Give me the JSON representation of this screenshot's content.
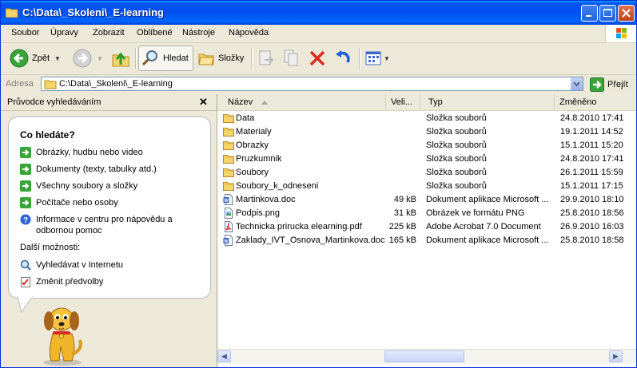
{
  "window": {
    "title": "C:\\Data\\_Skoleni\\_E-learning"
  },
  "menu": [
    "Soubor",
    "Úpravy",
    "Zobrazit",
    "Oblíbené",
    "Nástroje",
    "Nápověda"
  ],
  "toolbar": {
    "back": "Zpět",
    "search": "Hledat",
    "folders": "Složky"
  },
  "address": {
    "label": "Adresa",
    "path": "C:\\Data\\_Skoleni\\_E-learning",
    "go": "Přejít"
  },
  "search_pane": {
    "title": "Průvodce vyhledáváním",
    "question": "Co hledáte?",
    "links": [
      "Obrázky, hudbu nebo video",
      "Dokumenty (texty, tabulky atd.)",
      "Všechny soubory a složky",
      "Počítače nebo osoby",
      "Informace v centru pro nápovědu a odbornou pomoc"
    ],
    "more_label": "Další možnosti:",
    "more_links": [
      "Vyhledávat v Internetu",
      "Změnit předvolby"
    ]
  },
  "columns": {
    "name": "Název",
    "size": "Veli...",
    "type": "Typ",
    "modified": "Změněno"
  },
  "files": [
    {
      "name": "Data",
      "size": "",
      "type": "Složka souborů",
      "modified": "24.8.2010 17:41",
      "icon": "folder-icon"
    },
    {
      "name": "Materialy",
      "size": "",
      "type": "Složka souborů",
      "modified": "19.1.2011 14:52",
      "icon": "folder-icon"
    },
    {
      "name": "Obrazky",
      "size": "",
      "type": "Složka souborů",
      "modified": "15.1.2011 15:20",
      "icon": "folder-icon"
    },
    {
      "name": "Pruzkumnik",
      "size": "",
      "type": "Složka souborů",
      "modified": "24.8.2010 17:41",
      "icon": "folder-icon"
    },
    {
      "name": "Soubory",
      "size": "",
      "type": "Složka souborů",
      "modified": "26.1.2011 15:59",
      "icon": "folder-icon"
    },
    {
      "name": "Soubory_k_odneseni",
      "size": "",
      "type": "Složka souborů",
      "modified": "15.1.2011 17:15",
      "icon": "folder-icon"
    },
    {
      "name": "Martinkova.doc",
      "size": "49 kB",
      "type": "Dokument aplikace Microsoft ...",
      "modified": "29.9.2010 18:10",
      "icon": "word-doc-icon"
    },
    {
      "name": "Podpis.png",
      "size": "31 kB",
      "type": "Obrázek ve formátu PNG",
      "modified": "25.8.2010 18:56",
      "icon": "image-file-icon"
    },
    {
      "name": "Technicka prirucka elearning.pdf",
      "size": "225 kB",
      "type": "Adobe Acrobat 7.0 Document",
      "modified": "26.9.2010 16:03",
      "icon": "pdf-file-icon"
    },
    {
      "name": "Zaklady_IVT_Osnova_Martinkova.doc",
      "size": "165 kB",
      "type": "Dokument aplikace Microsoft ...",
      "modified": "25.8.2010 18:58",
      "icon": "word-doc-icon"
    }
  ]
}
